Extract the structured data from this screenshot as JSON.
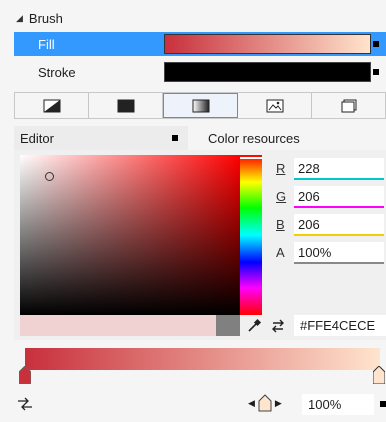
{
  "brush": {
    "header": "Brush"
  },
  "properties": [
    {
      "label": "Fill",
      "selected": true
    },
    {
      "label": "Stroke",
      "selected": false
    }
  ],
  "brush_tabs": [
    {
      "icon": "no-brush-icon",
      "active": false
    },
    {
      "icon": "solid-color-brush-icon",
      "active": false
    },
    {
      "icon": "gradient-brush-icon",
      "active": true
    },
    {
      "icon": "tile-brush-icon",
      "active": false
    },
    {
      "icon": "brush-resources-icon",
      "active": false
    }
  ],
  "editor": {
    "tab_label": "Editor",
    "resources_label": "Color resources"
  },
  "channels": [
    {
      "label": "R",
      "value": "228",
      "color": "#00c8c8"
    },
    {
      "label": "G",
      "value": "206",
      "color": "#ff00ff"
    },
    {
      "label": "B",
      "value": "206",
      "color": "#f0d000"
    },
    {
      "label": "A",
      "value": "100%",
      "color": "#888888"
    }
  ],
  "hex_value": "#FFE4CECE",
  "gradient": {
    "start_color": "#c8303c",
    "end_color": "#ffe4ce",
    "selected_stop": "end"
  },
  "offset_value": "100%"
}
